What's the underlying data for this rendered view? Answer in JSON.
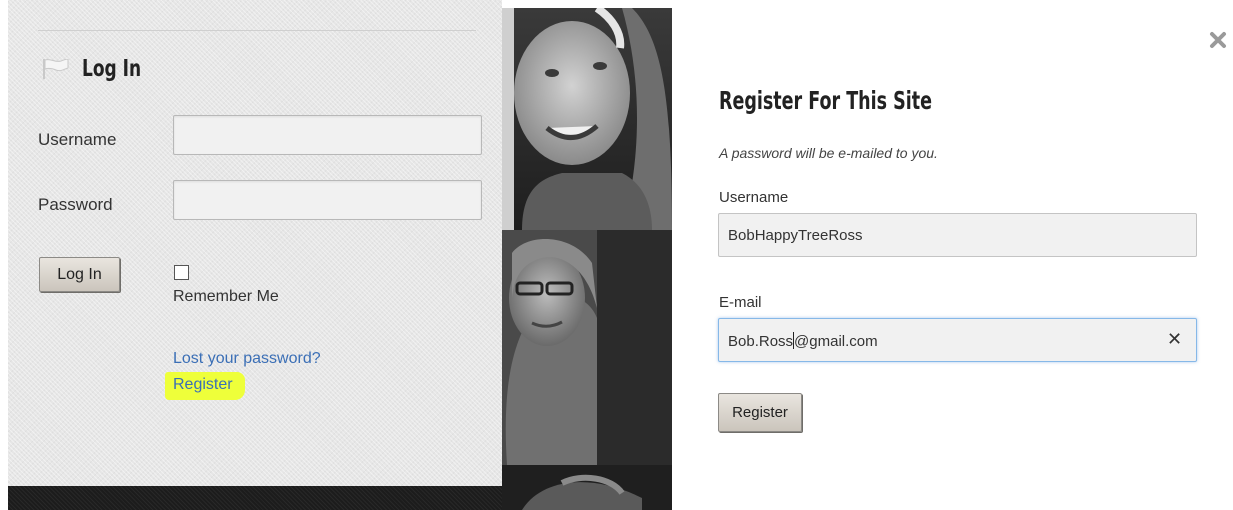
{
  "login": {
    "title": "Log In",
    "username_label": "Username",
    "username_value": "",
    "password_label": "Password",
    "password_value": "",
    "login_button": "Log In",
    "remember_label": "Remember Me",
    "remember_checked": false,
    "lost_password_link": "Lost your password?",
    "register_link": "Register",
    "highlight_color": "#eeff3a",
    "link_color": "#3b6fb6"
  },
  "register": {
    "title": "Register For This Site",
    "note": "A password will be e-mailed to you.",
    "username_label": "Username",
    "username_value": "BobHappyTreeRoss",
    "email_label": "E-mail",
    "email_value_before_caret": "Bob.Ross",
    "email_value_after_caret": "@gmail.com",
    "submit_button": "Register",
    "close_glyph": "✖",
    "clear_glyph": "✕"
  },
  "icons": {
    "flag": "flag-icon",
    "close": "close-icon",
    "clear": "clear-icon"
  }
}
